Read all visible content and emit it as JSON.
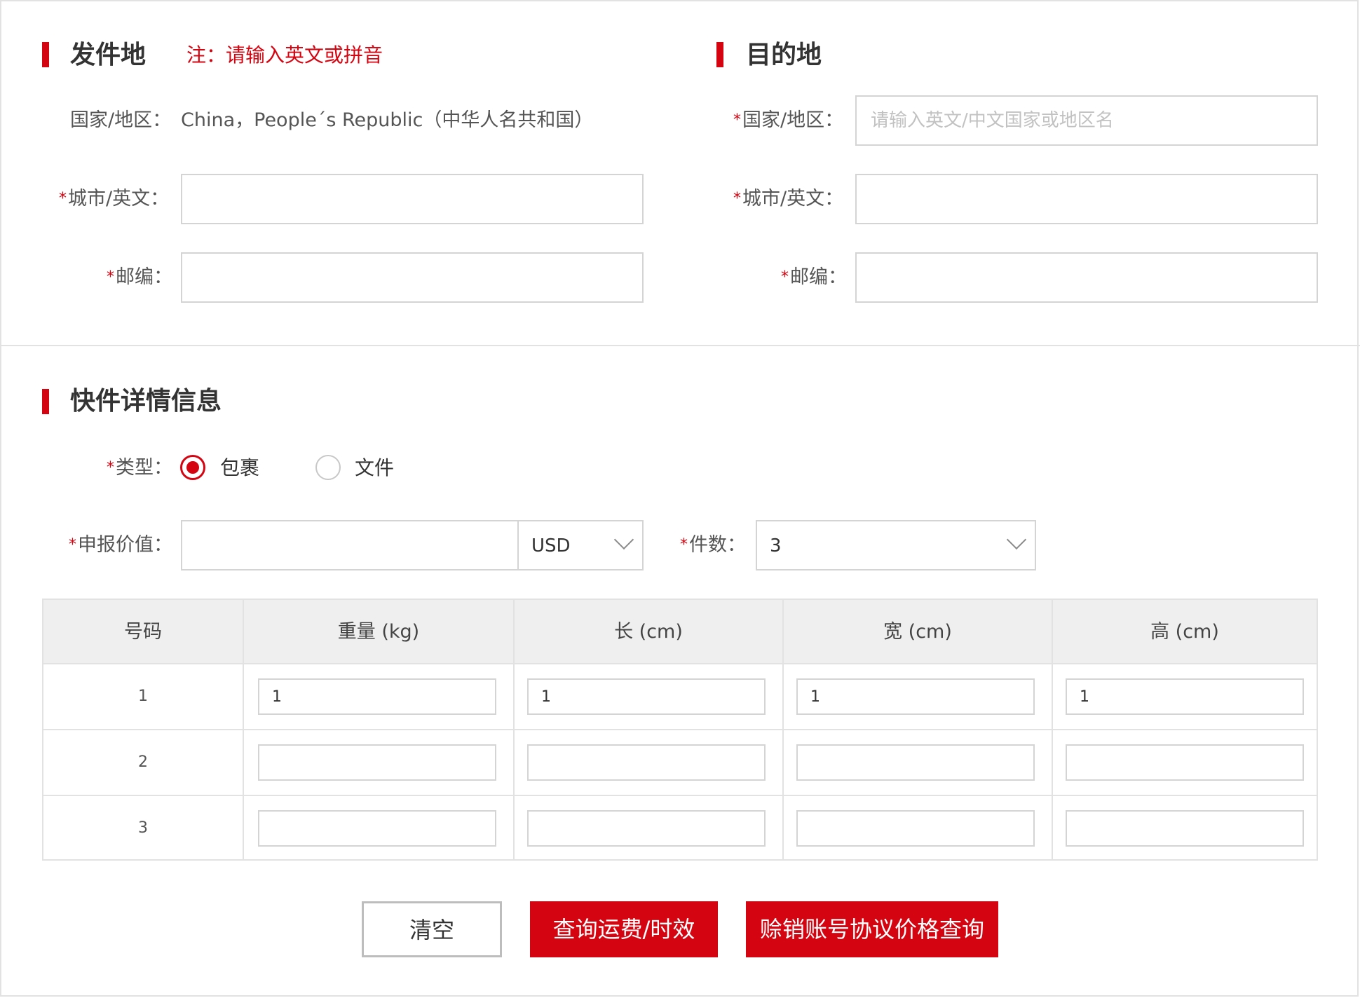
{
  "origin": {
    "title": "发件地",
    "note": "注：请输入英文或拼音",
    "country_label": "国家/地区：",
    "country_value": "China，People´s Republic（中华人名共和国）",
    "city_label": "城市/英文：",
    "city_value": "",
    "zip_label": "邮编：",
    "zip_value": ""
  },
  "destination": {
    "title": "目的地",
    "country_label": "国家/地区：",
    "country_placeholder": "请输入英文/中文国家或地区名",
    "country_value": "",
    "city_label": "城市/英文：",
    "city_value": "",
    "zip_label": "邮编：",
    "zip_value": ""
  },
  "required_mark": "*",
  "details": {
    "title": "快件详情信息",
    "type_label": "类型：",
    "type_options": [
      {
        "label": "包裹",
        "selected": true
      },
      {
        "label": "文件",
        "selected": false
      }
    ],
    "declared_value_label": "申报价值：",
    "declared_value": "",
    "currency": "USD",
    "pieces_label": "件数：",
    "pieces": "3"
  },
  "table": {
    "headers": [
      "号码",
      "重量 (kg)",
      "长 (cm)",
      "宽 (cm)",
      "高 (cm)"
    ],
    "rows": [
      {
        "num": "1",
        "weight": "1",
        "length": "1",
        "width": "1",
        "height": "1"
      },
      {
        "num": "2",
        "weight": "",
        "length": "",
        "width": "",
        "height": ""
      },
      {
        "num": "3",
        "weight": "",
        "length": "",
        "width": "",
        "height": ""
      }
    ]
  },
  "buttons": {
    "clear": "清空",
    "query": "查询运费/时效",
    "account_query": "赊销账号协议价格查询"
  },
  "colors": {
    "brand_red": "#d40511",
    "border": "#d4d4d4",
    "header_bg": "#efefef"
  }
}
